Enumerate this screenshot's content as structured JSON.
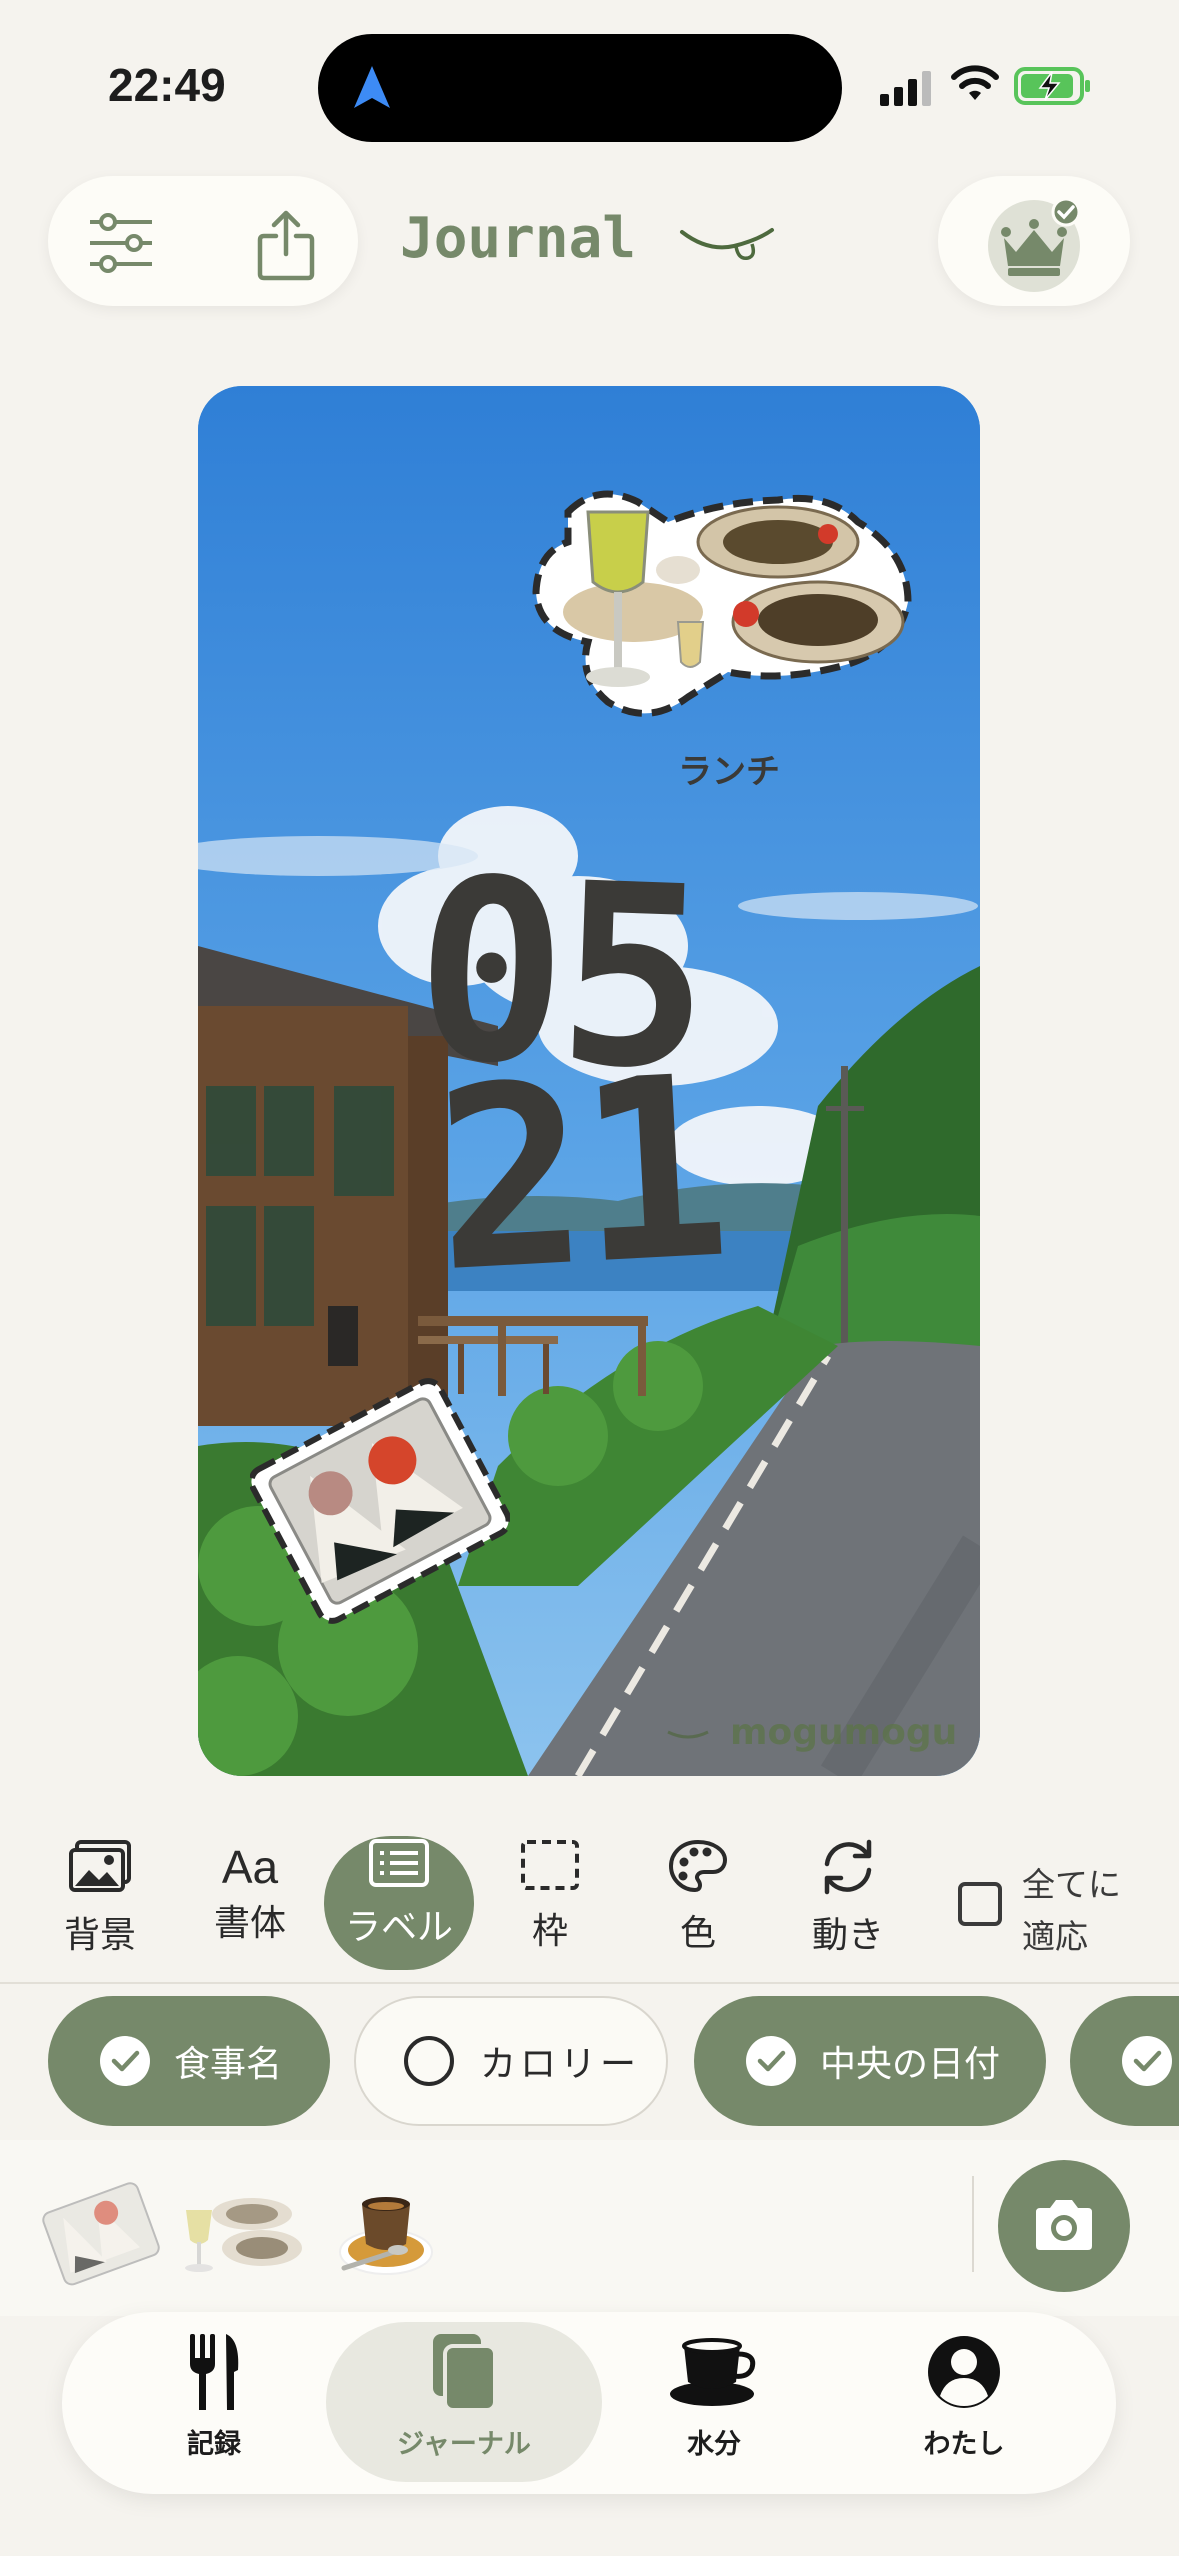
{
  "status": {
    "time": "22:49"
  },
  "header": {
    "title": "Journal"
  },
  "card": {
    "sticker_label": "ランチ",
    "date_month": "05",
    "date_day": "21",
    "watermark": "mogumogu"
  },
  "toolbar": {
    "items": [
      {
        "label": "背景",
        "icon": "image-icon"
      },
      {
        "label": "書体",
        "icon": "font-icon"
      },
      {
        "label": "ラベル",
        "icon": "label-icon",
        "selected": true
      },
      {
        "label": "枠",
        "icon": "frame-icon"
      },
      {
        "label": "色",
        "icon": "palette-icon"
      },
      {
        "label": "動き",
        "icon": "rotate-icon"
      }
    ],
    "apply_all": {
      "line1": "全てに",
      "line2": "適応",
      "checked": false
    }
  },
  "chips": [
    {
      "label": "食事名",
      "checked": true
    },
    {
      "label": "カロリー",
      "checked": false
    },
    {
      "label": "中央の日付",
      "checked": true
    }
  ],
  "tabs": [
    {
      "label": "記録",
      "icon": "fork-knife-icon"
    },
    {
      "label": "ジャーナル",
      "icon": "journal-icon",
      "selected": true
    },
    {
      "label": "水分",
      "icon": "cup-icon"
    },
    {
      "label": "わたし",
      "icon": "person-icon"
    }
  ],
  "colors": {
    "accent": "#76896a",
    "background": "#f5f3ee",
    "date_text": "#3b3a37"
  }
}
